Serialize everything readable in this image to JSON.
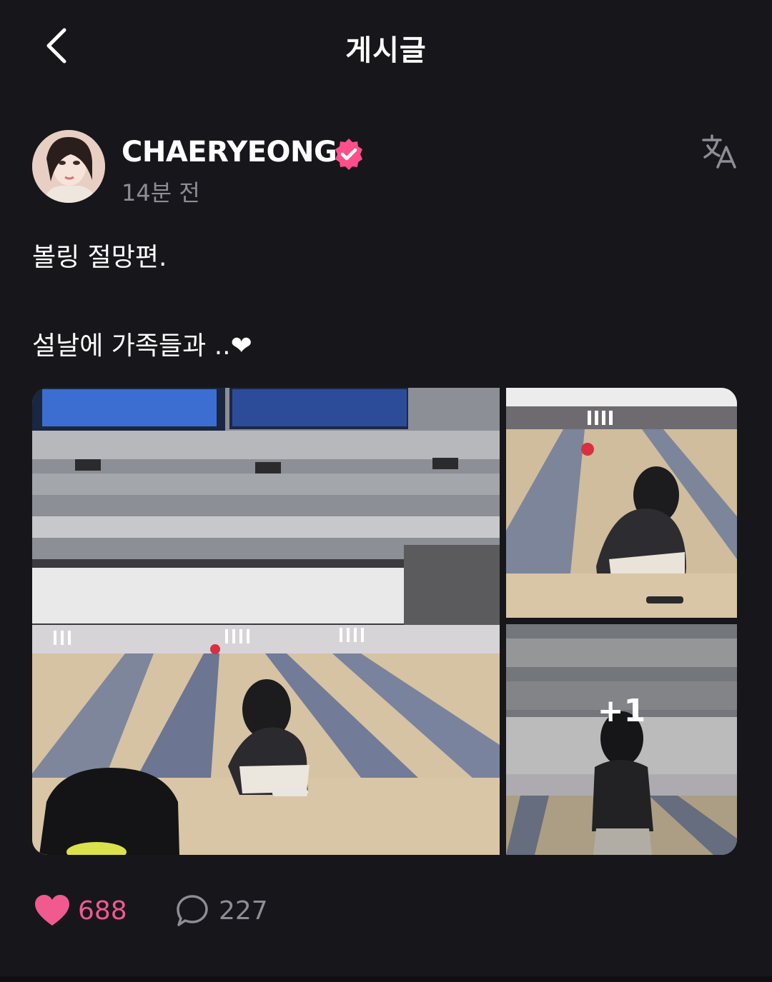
{
  "header": {
    "title": "게시글",
    "back_icon": "chevron-left-icon"
  },
  "author": {
    "name": "CHAERYEONG",
    "time": "14분 전",
    "verified_icon": "verified-badge-icon",
    "translate_icon": "translate-icon"
  },
  "post": {
    "text": "볼링 절망편.\n\n설날에 가족들과 ..❤"
  },
  "media": {
    "more_label": "+1",
    "photos": [
      "bowling-lane-photo",
      "bowling-crouch-photo",
      "bowling-standing-photo"
    ]
  },
  "actions": {
    "like_count": "688",
    "comment_count": "227",
    "like_icon": "heart-icon",
    "comment_icon": "comment-bubble-icon"
  },
  "colors": {
    "background": "#17161b",
    "accent_pink": "#f05a8e",
    "muted_text": "#8e8c94",
    "verified_pink": "#ff4f8b"
  }
}
